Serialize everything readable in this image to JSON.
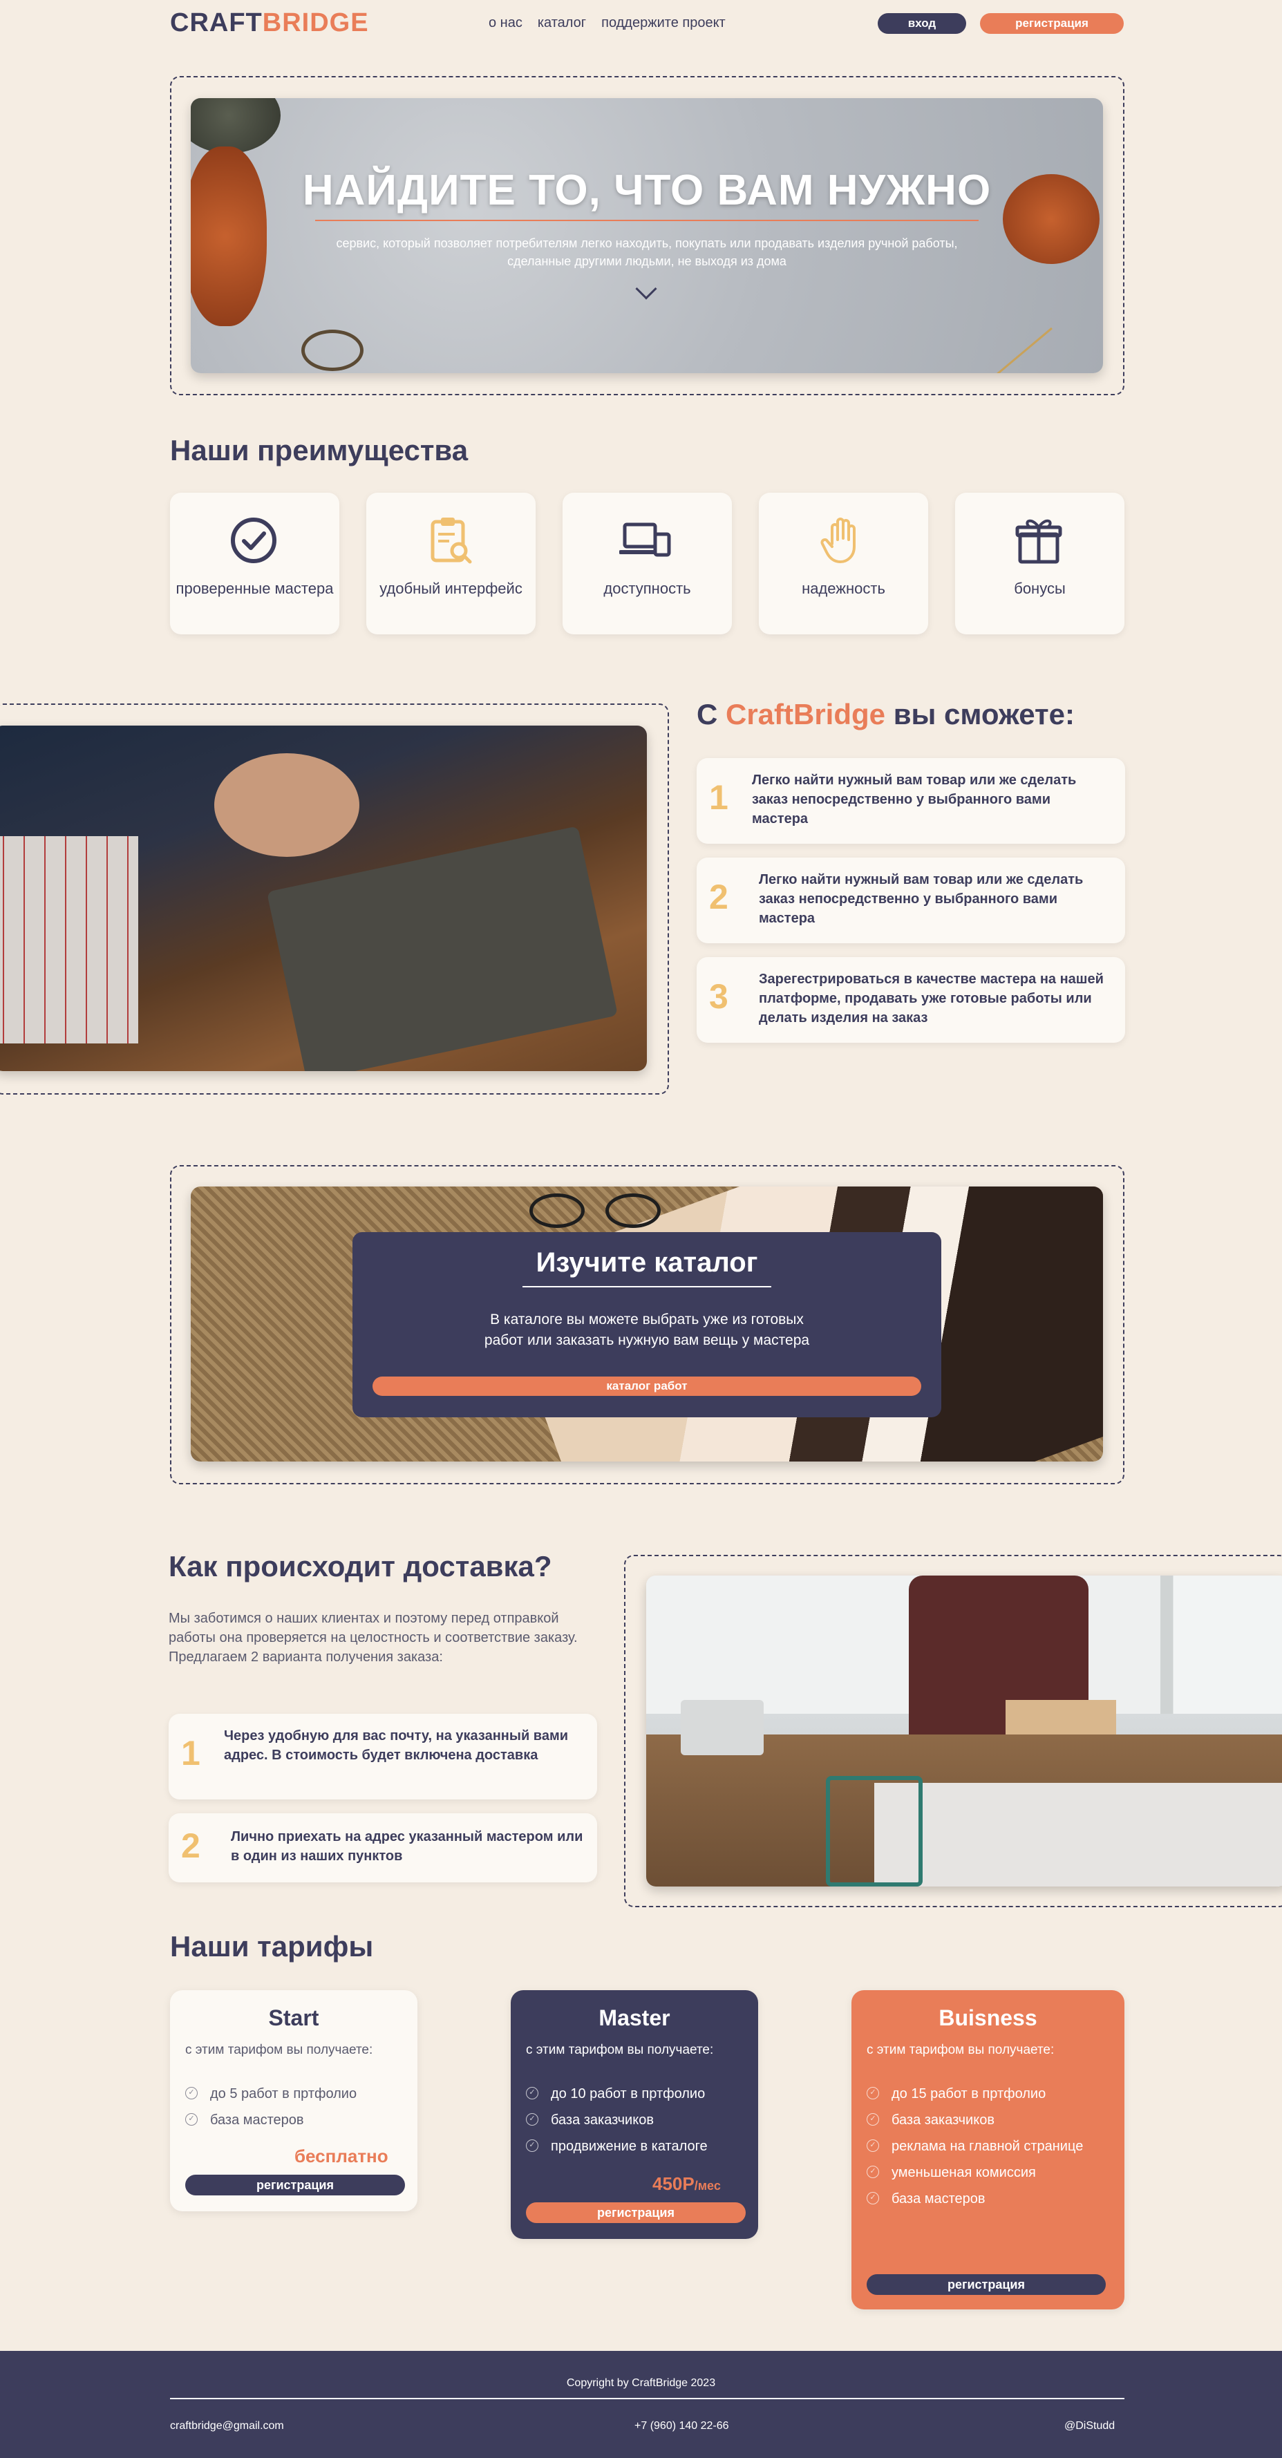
{
  "header": {
    "logo_part1": "CRAFT",
    "logo_part2": "BRIDGE",
    "nav": [
      "о нас",
      "каталог",
      "поддержите проект"
    ],
    "login_label": "вход",
    "register_label": "регистрация"
  },
  "hero": {
    "title": "НАЙДИТЕ ТО, ЧТО ВАМ НУЖНО",
    "subtitle_line1": "сервис, который позволяет потребителям легко находить, покупать или продавать изделия ручной работы,",
    "subtitle_line2": "сделанные другими людьми, не выходя из дома"
  },
  "advantages": {
    "title": "Наши преимущества",
    "items": [
      {
        "label": "проверенные мастера",
        "icon": "check-circle-icon"
      },
      {
        "label": "удобный интерфейс",
        "icon": "clipboard-search-icon"
      },
      {
        "label": "доступность",
        "icon": "devices-icon"
      },
      {
        "label": "надежность",
        "icon": "hand-icon"
      },
      {
        "label": "бонусы",
        "icon": "gift-icon"
      }
    ]
  },
  "features": {
    "title_pre": "С ",
    "title_brand": "CraftBridge",
    "title_post": " вы сможете:",
    "items": [
      {
        "num": "1",
        "text": "Легко найти нужный вам товар или же сделать заказ непосредственно у выбранного вами мастера"
      },
      {
        "num": "2",
        "text": "Легко найти нужный вам товар или же сделать заказ непосредственно у выбранного вами мастера"
      },
      {
        "num": "3",
        "text": "Зарегестрироваться в качестве мастера на нашей платформе, продавать уже готовые работы или делать изделия на заказ"
      }
    ]
  },
  "catalog": {
    "title": "Изучите каталог",
    "text_line1": "В каталоге вы можете выбрать уже из готовых",
    "text_line2": "работ или заказать нужную вам вещь у мастера",
    "button": "каталог работ"
  },
  "delivery": {
    "title": "Как происходит доставка?",
    "text": "Мы заботимся о наших клиентах и поэтому перед отправкой работы она проверяется на целостность и соответствие заказу. Предлагаем 2 варианта получения заказа:",
    "items": [
      {
        "num": "1",
        "text": "Через удобную для вас почту, на указанный вами адрес. В стоимость будет включена доставка"
      },
      {
        "num": "2",
        "text": "Лично приехать на адрес указанный мастером или в один из наших пунктов"
      }
    ]
  },
  "tariffs": {
    "title": "Наши тарифы",
    "plans": [
      {
        "name": "Start",
        "sub": "с этим тарифом вы получаете:",
        "features": [
          "до 5 работ в пртфолио",
          "база мастеров"
        ],
        "price": "бесплатно",
        "price_unit": "",
        "button": "регистрация"
      },
      {
        "name": "Master",
        "sub": "с этим тарифом вы получаете:",
        "features": [
          "до 10 работ в пртфолио",
          "база заказчиков",
          "продвижение в каталоге"
        ],
        "price": "450Р",
        "price_unit": "/мес",
        "button": "регистрация"
      },
      {
        "name": "Buisness",
        "sub": "с этим тарифом вы получаете:",
        "features": [
          "до 15 работ в пртфолио",
          "база заказчиков",
          "реклама на главной странице",
          "уменьшеная комиссия",
          "база мастеров"
        ],
        "price": "",
        "price_unit": "",
        "button": "регистрация"
      }
    ]
  },
  "footer": {
    "copyright": "Copyright by CraftBridge 2023",
    "email": "craftbridge@gmail.com",
    "phone": "+7 (960) 140 22-66",
    "social": "@DiStudd"
  },
  "colors": {
    "navy": "#3d3d5c",
    "accent": "#e97d58",
    "background": "#f5ede3",
    "card": "#fcf9f4",
    "number": "#f0c070"
  }
}
